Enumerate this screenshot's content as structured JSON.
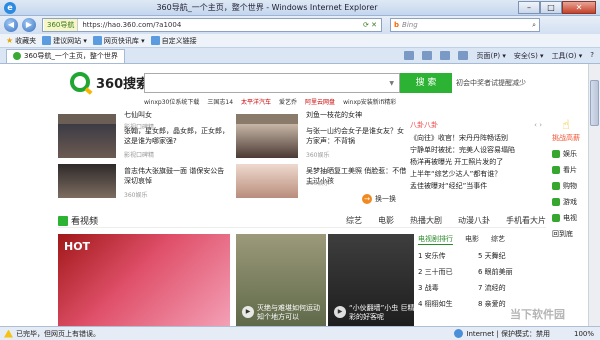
{
  "window": {
    "title": "360导航_一个主页，整个世界 - Windows Internet Explorer",
    "min": "–",
    "max": "□",
    "close": "✕"
  },
  "address": {
    "site_tag": "360导航",
    "url": "https://hao.360.com/?a1004",
    "search_engine": "b",
    "search_placeholder": "Bing"
  },
  "favorites": {
    "label": "收藏夹",
    "items": [
      "建议网站 ▾",
      "网页快讯库 ▾",
      "自定义链接"
    ]
  },
  "tab": {
    "label": "360导航_一个主页，整个世界"
  },
  "commandbar": {
    "page": "页面(P) ▾",
    "safety": "安全(S) ▾",
    "tools": "工具(O) ▾"
  },
  "search": {
    "logo_text": "360搜索",
    "button": "搜 索",
    "note": "初会中奖者试提醒减少",
    "hotwords": [
      "winxp30位系统下载",
      "三国志14",
      "太平洋汽车",
      "爱艺乔",
      "阿里云网盘",
      "winxp安装新ifi精彩"
    ]
  },
  "news": [
    {
      "text": "七仙叫女",
      "src": "影视口碑精"
    },
    {
      "text": "刘鱼一枝花的女神",
      "src": "360娱乐"
    },
    {
      "text": "张翰，星女郎，晶女郎，正女郎，这是谁为哪家强?",
      "src": "影视口碑精"
    },
    {
      "text": "与张一山约会女子是谁女友？女方家声：不背锅",
      "src": "360娱乐"
    },
    {
      "text": "曾志伟大张旗鼓一面 谐保安公告深切哀悼",
      "src": "360娱乐"
    },
    {
      "text": "吴梦抽晒复工美照 俏脸惹：不借主过小孩",
      "src": "360娱乐"
    }
  ],
  "refresh": "换一换",
  "gossip": {
    "title": "八卦八卦",
    "arrows": "‹ ›",
    "items": [
      "《向往》收官！宋丹丹阵畅话别",
      "宁静单时被扰：完美人设容易塌陷",
      "杨洋再被曝光 开工照片发的了",
      "上半年“综艺少达人”都有谁？",
      "孟佳被曝对“经纪”当事件"
    ]
  },
  "sidenav": {
    "top": "挑战高薪",
    "items": [
      "娱乐",
      "看片",
      "购物",
      "游戏",
      "电视",
      "回到底"
    ]
  },
  "video": {
    "title": "看视频",
    "tabs": [
      "综艺",
      "电影",
      "热播大剧",
      "动漫八卦",
      "手机看大片"
    ],
    "hot_label": "HOT",
    "cards": [
      {
        "cap": "灭绝与难堪如何运动 知个地方可以"
      },
      {
        "cap": "“小伙翻墙”小虫 巨精彩的好客呢"
      }
    ]
  },
  "rank": {
    "tabs": [
      "电视剧排行",
      "电影",
      "综艺"
    ],
    "items": [
      "1 安乐传",
      "2 三十而已",
      "3 战毒",
      "4 栩栩如生",
      "5 天舞纪",
      "6 眼前美丽",
      "7 流经的",
      "8 亲爱的"
    ]
  },
  "status": {
    "text": "已完毕，但网页上有错误。",
    "zone": "Internet | 保护模式：禁用",
    "zoom": "100%"
  },
  "watermark": "当下软件园"
}
